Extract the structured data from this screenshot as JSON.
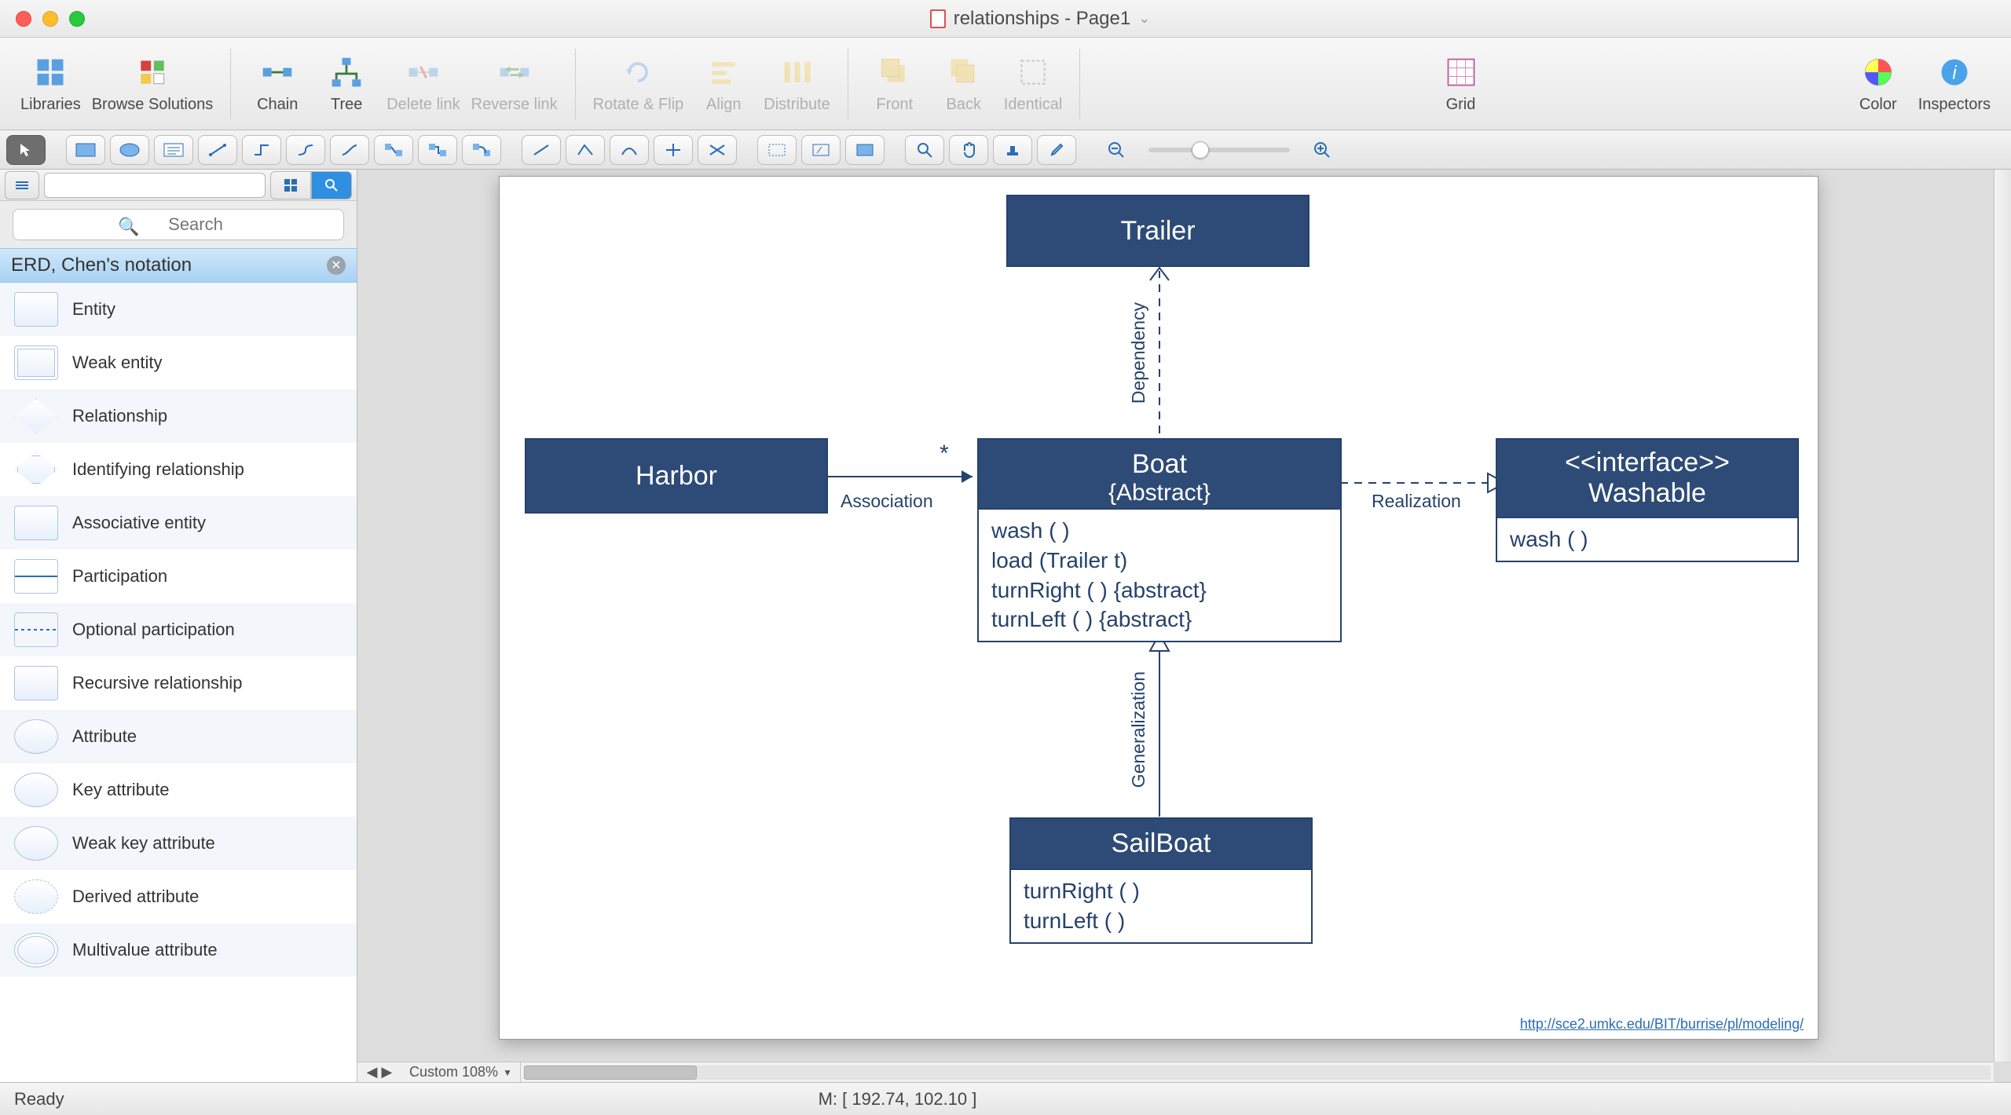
{
  "window": {
    "title": "relationships - Page1"
  },
  "toolbar": {
    "libraries": "Libraries",
    "browse": "Browse Solutions",
    "chain": "Chain",
    "tree": "Tree",
    "delete_link": "Delete link",
    "reverse_link": "Reverse link",
    "rotate_flip": "Rotate & Flip",
    "align": "Align",
    "distribute": "Distribute",
    "front": "Front",
    "back": "Back",
    "identical": "Identical",
    "grid": "Grid",
    "color": "Color",
    "inspectors": "Inspectors"
  },
  "search": {
    "placeholder": "Search"
  },
  "library": {
    "header": "ERD, Chen's notation",
    "items": [
      "Entity",
      "Weak entity",
      "Relationship",
      "Identifying relationship",
      "Associative entity",
      "Participation",
      "Optional participation",
      "Recursive relationship",
      "Attribute",
      "Key attribute",
      "Weak key attribute",
      "Derived attribute",
      "Multivalue attribute"
    ]
  },
  "diagram": {
    "trailer": {
      "title": "Trailer"
    },
    "harbor": {
      "title": "Harbor"
    },
    "boat": {
      "title": "Boat",
      "subtitle": "{Abstract}",
      "methods": [
        "wash ( )",
        "load (Trailer t)",
        "turnRight ( ) {abstract}",
        "turnLeft ( ) {abstract}"
      ]
    },
    "washable": {
      "stereo": "<<interface>>",
      "title": "Washable",
      "methods": [
        "wash ( )"
      ]
    },
    "sailboat": {
      "title": "SailBoat",
      "methods": [
        "turnRight ( )",
        "turnLeft ( )"
      ]
    },
    "labels": {
      "association": "Association",
      "star": "*",
      "dependency": "Dependency",
      "realization": "Realization",
      "generalization": "Generalization"
    },
    "url": "http://sce2.umkc.edu/BIT/burrise/pl/modeling/"
  },
  "footer": {
    "zoom_label": "Custom 108%",
    "status": "Ready",
    "mouse": "M: [ 192.74, 102.10 ]"
  }
}
